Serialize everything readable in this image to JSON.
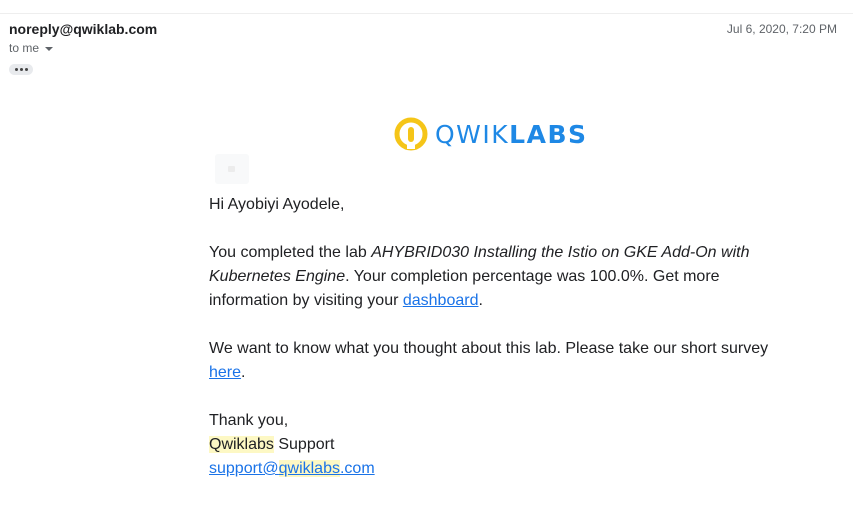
{
  "email": {
    "sender": "noreply@qwiklab.com",
    "recipient_label": "to me",
    "date": "Jul 6, 2020, 7:20 PM"
  },
  "logo": {
    "part1": "QWIK",
    "part2": "LABS",
    "brand_color": "#1e88e5",
    "icon_color": "#f5c518"
  },
  "message": {
    "greeting": "Hi Ayobiyi Ayodele,",
    "p1_prefix": "You completed the lab ",
    "lab_name": "AHYBRID030 Installing the Istio on GKE Add-On with Kubernetes Engine",
    "p1_middle": ". Your completion percentage was 100.0%. Get more information by visiting your ",
    "dashboard_link": "dashboard",
    "p1_suffix": ".",
    "p2_prefix": "We want to know what you thought about this lab. Please take our short survey ",
    "survey_link": "here",
    "p2_suffix": ".",
    "thanks": "Thank you,",
    "sig_company": "Qwiklabs",
    "sig_support": " Support",
    "email_pre": "support@",
    "email_domain": "qwiklabs",
    "email_post": ".com"
  },
  "colors": {
    "link": "#1a73e8",
    "highlight": "#fdf8c4"
  }
}
